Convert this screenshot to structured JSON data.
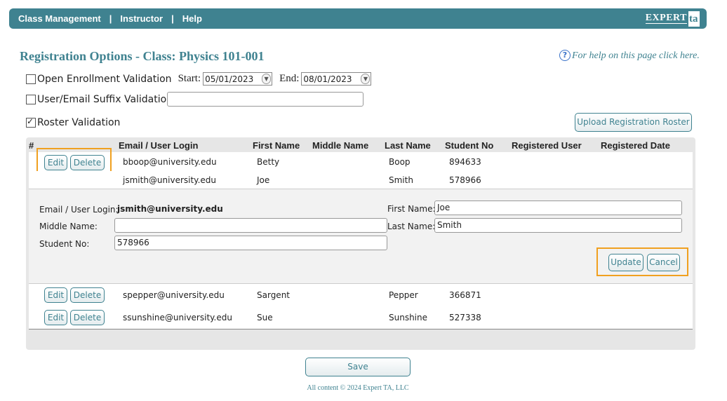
{
  "nav": {
    "items": [
      "Class Management",
      "Instructor",
      "Help"
    ],
    "separator": "|",
    "logo_text": "EXPERT",
    "logo_mark": "ta"
  },
  "page": {
    "title": "Registration Options - Class: Physics 101-001",
    "help_text": "For help on this page click here.",
    "help_icon": "?"
  },
  "options": {
    "open_enrollment": {
      "label": "Open Enrollment Validation",
      "checked": false,
      "start_label": "Start:",
      "start_value": "05/01/2023",
      "end_label": "End:",
      "end_value": "08/01/2023"
    },
    "suffix": {
      "label": "User/Email Suffix Validation",
      "checked": false,
      "value": ""
    },
    "roster": {
      "label": "Roster Validation",
      "checked": true
    }
  },
  "upload_button": "Upload Registration Roster",
  "table": {
    "headers": [
      "#",
      "Email / User Login",
      "First Name",
      "Middle Name",
      "Last Name",
      "Student No",
      "Registered User",
      "Registered Date"
    ],
    "rows": [
      {
        "email": "bboop@university.edu",
        "first": "Betty",
        "middle": "",
        "last": "Boop",
        "student_no": "894633"
      },
      {
        "email": "jsmith@university.edu",
        "first": "Joe",
        "middle": "",
        "last": "Smith",
        "student_no": "578966"
      },
      {
        "email": "spepper@university.edu",
        "first": "Sargent",
        "middle": "",
        "last": "Pepper",
        "student_no": "366871"
      },
      {
        "email": "ssunshine@university.edu",
        "first": "Sue",
        "middle": "",
        "last": "Sunshine",
        "student_no": "527338"
      }
    ],
    "edit_label": "Edit",
    "delete_label": "Delete"
  },
  "edit_form": {
    "email_label": "Email / User Login:",
    "email_value": "jsmith@university.edu",
    "first_label": "First Name:",
    "first_value": "Joe",
    "middle_label": "Middle Name:",
    "middle_value": "",
    "last_label": "Last Name:",
    "last_value": "Smith",
    "student_label": "Student No:",
    "student_value": "578966",
    "update_label": "Update",
    "cancel_label": "Cancel"
  },
  "save_label": "Save",
  "footer": "All content © 2024 Expert TA, LLC",
  "colors": {
    "brand": "#3f8290",
    "highlight": "#f0a020"
  }
}
